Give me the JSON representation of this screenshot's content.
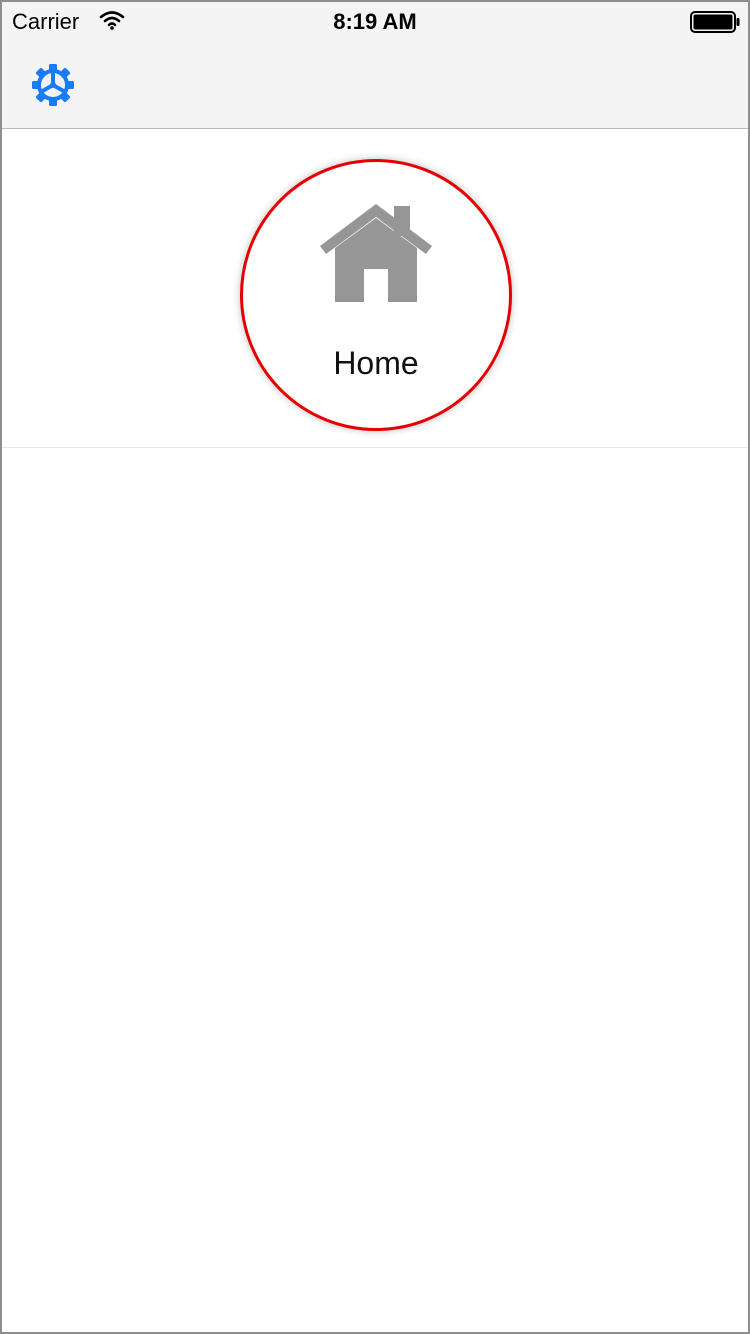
{
  "status_bar": {
    "carrier": "Carrier",
    "time": "8:19 AM",
    "wifi_icon": "wifi-icon",
    "battery_icon": "battery-icon"
  },
  "nav_bar": {
    "settings_icon": "gear-icon",
    "accent_color": "#1a7cf5"
  },
  "home_cell": {
    "label": "Home",
    "icon": "house-icon",
    "icon_color": "#969696",
    "ring_color": "#e60000"
  }
}
